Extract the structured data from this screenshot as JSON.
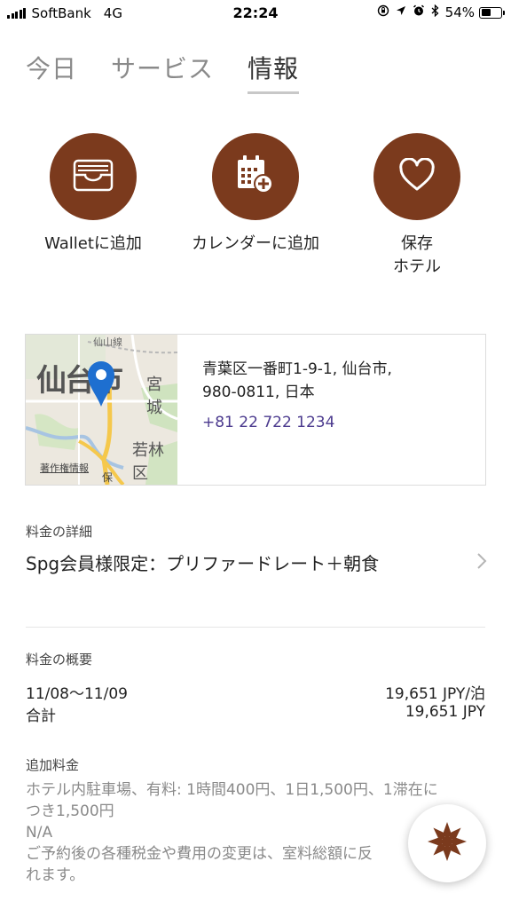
{
  "status_bar": {
    "carrier": "SoftBank",
    "network": "4G",
    "time": "22:24",
    "battery": "54%",
    "battery_level": 0.54,
    "icons": [
      "signal-icon",
      "orientation-lock-icon",
      "location-icon",
      "alarm-icon",
      "bluetooth-icon",
      "battery-icon"
    ]
  },
  "tabs": [
    {
      "label": "今日",
      "active": false
    },
    {
      "label": "サービス",
      "active": false
    },
    {
      "label": "情報",
      "active": true
    }
  ],
  "actions": [
    {
      "label": "Walletに追加",
      "icon": "wallet-icon"
    },
    {
      "label": "カレンダーに追加",
      "icon": "calendar-add-icon"
    },
    {
      "label_line1": "保存",
      "label_line2": "ホテル",
      "icon": "heart-icon"
    }
  ],
  "address": {
    "line1": "青葉区一番町1-9-1, 仙台市,",
    "line2": "980-0811, 日本",
    "phone": "+81 22 722 1234",
    "map": {
      "city_label": "仙台市",
      "labels": [
        "宮城",
        "若林区",
        "仙山線"
      ],
      "credit": "著作権情報",
      "road_label": "保"
    }
  },
  "rate_details": {
    "label": "料金の詳細",
    "value": "Spg会員様限定：プリファードレート＋朝食"
  },
  "rate_summary": {
    "label": "料金の概要",
    "dates": "11/08〜11/09",
    "nightly": "19,651 JPY/泊",
    "total_label": "合計",
    "total": "19,651 JPY"
  },
  "extra_charges": {
    "label": "追加料金",
    "line1": "ホテル内駐車場、有料: 1時間400円、1日1,500円、1滞在に",
    "line2": "つき1,500円",
    "line3": "N/A",
    "line4": "ご予約後の各種税金や費用の変更は、室料総額に反",
    "line5": "れます。"
  },
  "colors": {
    "accent": "#7b3a1d",
    "phone_link": "#4b3a8e",
    "map_pin": "#1e6fd0"
  }
}
